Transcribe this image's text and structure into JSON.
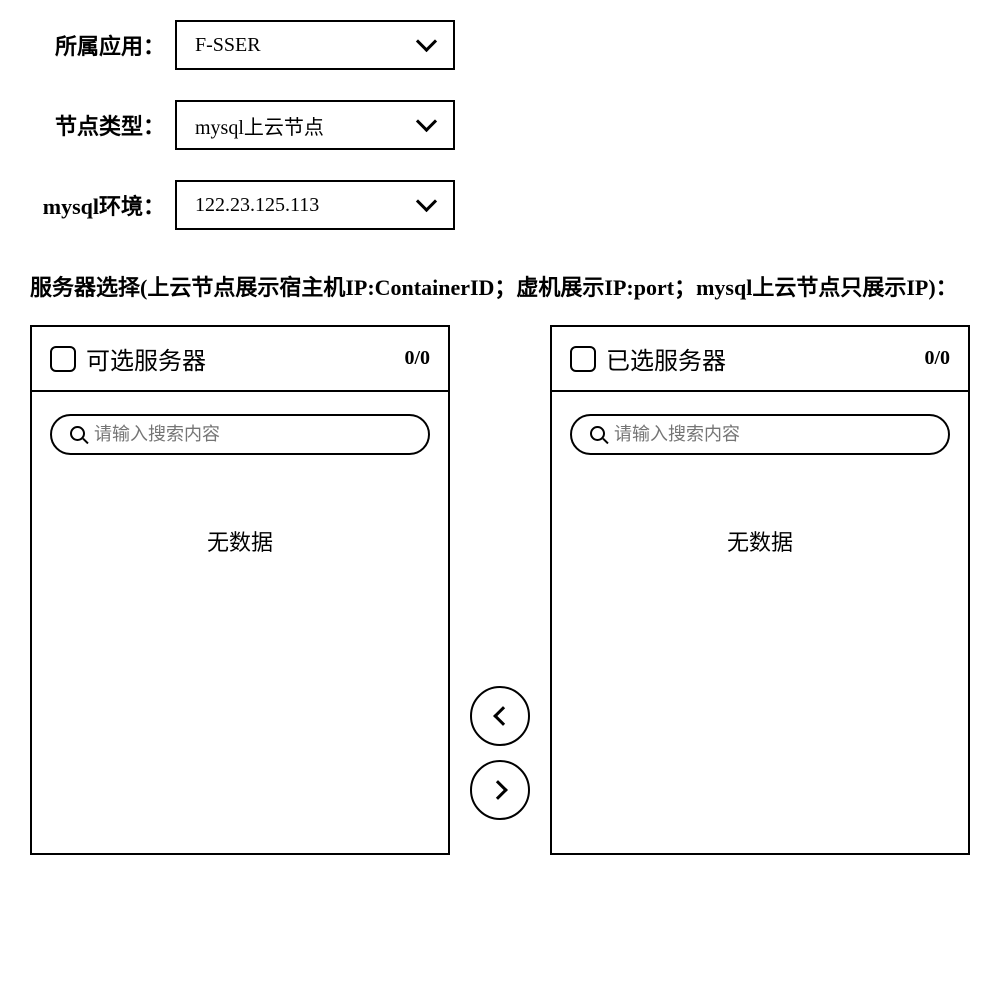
{
  "form": {
    "app_label": "所属应用：",
    "app_value": "F-SSER",
    "node_type_label": "节点类型：",
    "node_type_value": "mysql上云节点",
    "env_label": "mysql环境：",
    "env_value": "122.23.125.113"
  },
  "server_select_label": "服务器选择(上云节点展示宿主机IP:ContainerID；虚机展示IP:port；mysql上云节点只展示IP)：",
  "transfer": {
    "available": {
      "title": "可选服务器",
      "count": "0/0",
      "search_placeholder": "请输入搜索内容",
      "no_data": "无数据"
    },
    "selected": {
      "title": "已选服务器",
      "count": "0/0",
      "search_placeholder": "请输入搜索内容",
      "no_data": "无数据"
    }
  }
}
